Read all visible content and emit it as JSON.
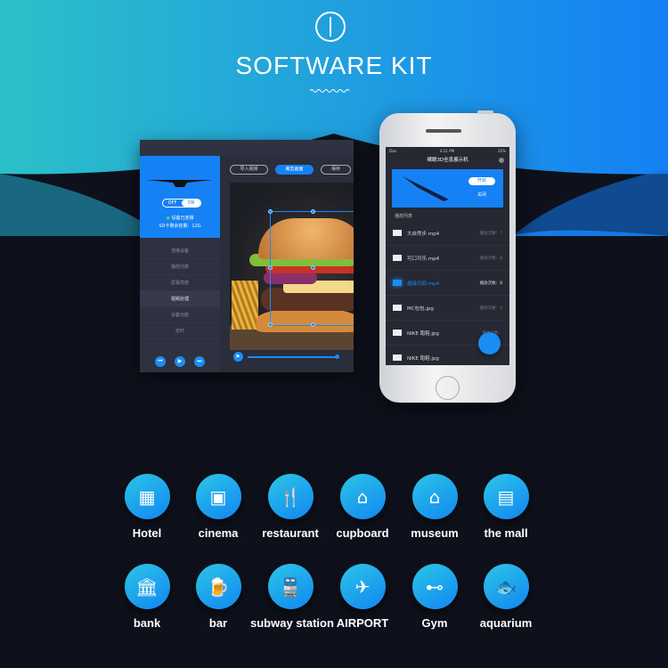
{
  "header": {
    "title": "SOFTWARE KIT",
    "logo_icon": "hologram-fan-icon"
  },
  "desktop": {
    "toggle": {
      "off": "OFF",
      "on": "ON"
    },
    "status": "设备已连接",
    "storage": "SD卡剩余容量：12G",
    "menu": [
      "连接设备",
      "播放列表",
      "屏幕亮度",
      "视频处理",
      "设备功能",
      "定时"
    ],
    "active_menu": "视频处理",
    "buttons": {
      "import": "导入视频",
      "crop": "裁剪画面",
      "save": "保存"
    }
  },
  "phone": {
    "status_bar": {
      "carrier": "Dao",
      "time": "4:21 PM",
      "battery": "22%"
    },
    "title": "裸眼3D全息展示机",
    "open": "开启",
    "close": "关闭",
    "list_title": "播放列表",
    "items": [
      {
        "name": "大自然步.mp4",
        "count": "播放次数：7"
      },
      {
        "name": "可口可乐.mp4",
        "count": "播放次数：8"
      },
      {
        "name": "超级玛丽.mp4",
        "count": "播放次数：8"
      },
      {
        "name": "MC包包.jpg",
        "count": "播放次数：4"
      },
      {
        "name": "NIKE 跑鞋.jpg",
        "count": "播放次数："
      },
      {
        "name": "NIKE 跑鞋.jpg",
        "count": ""
      }
    ],
    "active_index": 2
  },
  "venues": [
    "Hotel",
    "cinema",
    "restaurant",
    "cupboard",
    "museum",
    "the mall",
    "bank",
    "bar",
    "subway station",
    "AIRPORT",
    "Gym",
    "aquarium"
  ],
  "colors": {
    "accent": "#1581f5",
    "gradient_start": "#2bc0c8",
    "gradient_end": "#1580f5",
    "background": "#0e111b"
  }
}
